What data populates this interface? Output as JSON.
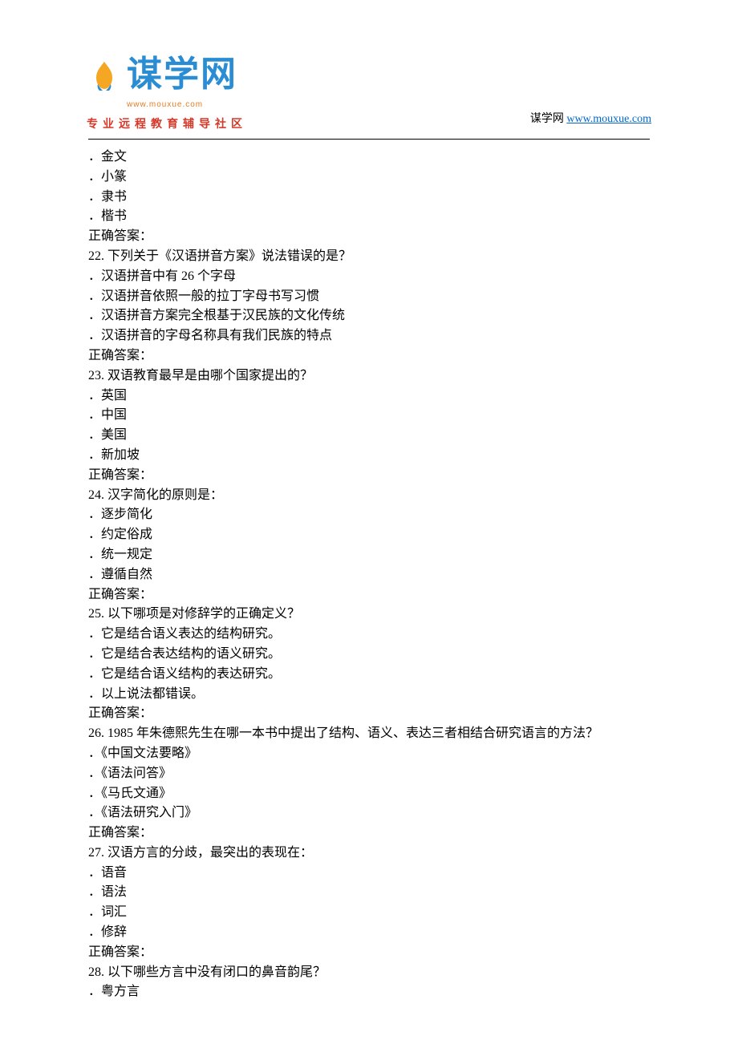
{
  "header": {
    "logo_text": "谋学网",
    "logo_url": "www.mouxue.com",
    "tagline": "专业远程教育辅导社区",
    "site_label": "谋学网 ",
    "site_link": "www.mouxue.com",
    "site_href": "http://www.mouxue.com"
  },
  "leading_options": [
    "．金文",
    "．小篆",
    "．隶书",
    "．楷书"
  ],
  "leading_answer": "正确答案：",
  "questions": [
    {
      "num": "22.   ",
      "text": "下列关于《汉语拼音方案》说法错误的是？",
      "options": [
        "．汉语拼音中有 26 个字母",
        "．汉语拼音依照一般的拉丁字母书写习惯",
        "．汉语拼音方案完全根基于汉民族的文化传统",
        "．汉语拼音的字母名称具有我们民族的特点"
      ],
      "answer": "正确答案："
    },
    {
      "num": "23.   ",
      "text": "双语教育最早是由哪个国家提出的？",
      "options": [
        "．英国",
        "．中国",
        "．美国",
        "．新加坡"
      ],
      "answer": "正确答案："
    },
    {
      "num": "24.   ",
      "text": "汉字简化的原则是：",
      "options": [
        "．逐步简化",
        "．约定俗成",
        "．统一规定",
        "．遵循自然"
      ],
      "answer": "正确答案："
    },
    {
      "num": "25.   ",
      "text": "以下哪项是对修辞学的正确定义？",
      "options": [
        "．它是结合语义表达的结构研究。",
        "．它是结合表达结构的语义研究。",
        "．它是结合语义结构的表达研究。",
        "．以上说法都错误。"
      ],
      "answer": "正确答案："
    },
    {
      "num": "26.   ",
      "text": "1985 年朱德熙先生在哪一本书中提出了结构、语义、表达三者相结合研究语言的方法？",
      "options": [
        "．《中国文法要略》",
        "．《语法问答》",
        "．《马氏文通》",
        "．《语法研究入门》"
      ],
      "answer": "正确答案："
    },
    {
      "num": "27.   ",
      "text": "汉语方言的分歧，最突出的表现在：",
      "options": [
        "．语音",
        "．语法",
        "．词汇",
        "．修辞"
      ],
      "answer": "正确答案："
    },
    {
      "num": "28.   ",
      "text": "以下哪些方言中没有闭口的鼻音韵尾？",
      "options": [
        "．粤方言"
      ],
      "answer": null
    }
  ]
}
